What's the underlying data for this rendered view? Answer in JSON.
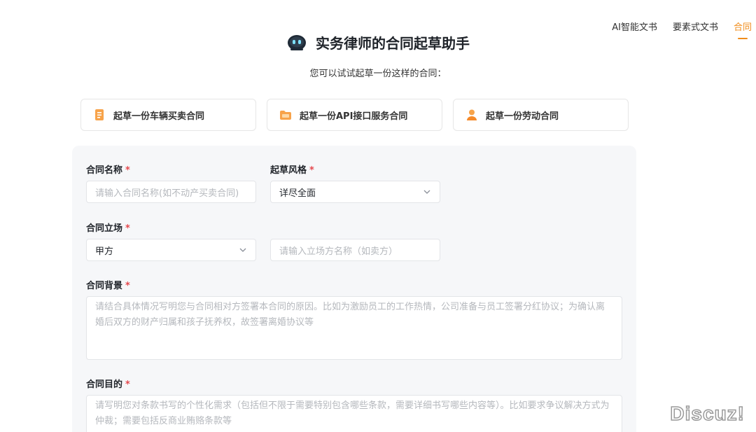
{
  "topnav": {
    "items": [
      {
        "label": "AI智能文书",
        "active": false
      },
      {
        "label": "要素式文书",
        "active": false
      },
      {
        "label": "合同",
        "active": true
      }
    ],
    "accent_color": "#f08c1a"
  },
  "hero": {
    "icon": "robot-icon",
    "title": "实务律师的合同起草助手",
    "subtitle": "您可以试试起草一份这样的合同："
  },
  "examples": [
    {
      "label": "起草一份车辆买卖合同",
      "icon": "document-icon"
    },
    {
      "label": "起草一份API接口服务合同",
      "icon": "folder-icon"
    },
    {
      "label": "起草一份劳动合同",
      "icon": "person-icon"
    }
  ],
  "form": {
    "contract_name": {
      "label": "合同名称",
      "required_mark": "*",
      "placeholder": "请输入合同名称(如不动产买卖合同)"
    },
    "draft_style": {
      "label": "起草风格",
      "required_mark": "*",
      "value": "详尽全面"
    },
    "stance": {
      "label": "合同立场",
      "required_mark": "*",
      "value": "甲方",
      "name_placeholder": "请输入立场方名称（如卖方）"
    },
    "background": {
      "label": "合同背景",
      "required_mark": "*",
      "placeholder": "请结合具体情况写明您与合同相对方签署本合同的原因。比如为激励员工的工作热情，公司准备与员工签署分红协议；为确认离婚后双方的财产归属和孩子抚养权，故签署离婚协议等"
    },
    "purpose": {
      "label": "合同目的",
      "required_mark": "*",
      "placeholder": "请写明您对条款书写的个性化需求（包括但不限于需要特别包含哪些条款，需要详细书写哪些内容等）。比如要求争议解决方式为仲裁；需要包括反商业贿赂条款等"
    }
  },
  "watermark": "Discuz!"
}
